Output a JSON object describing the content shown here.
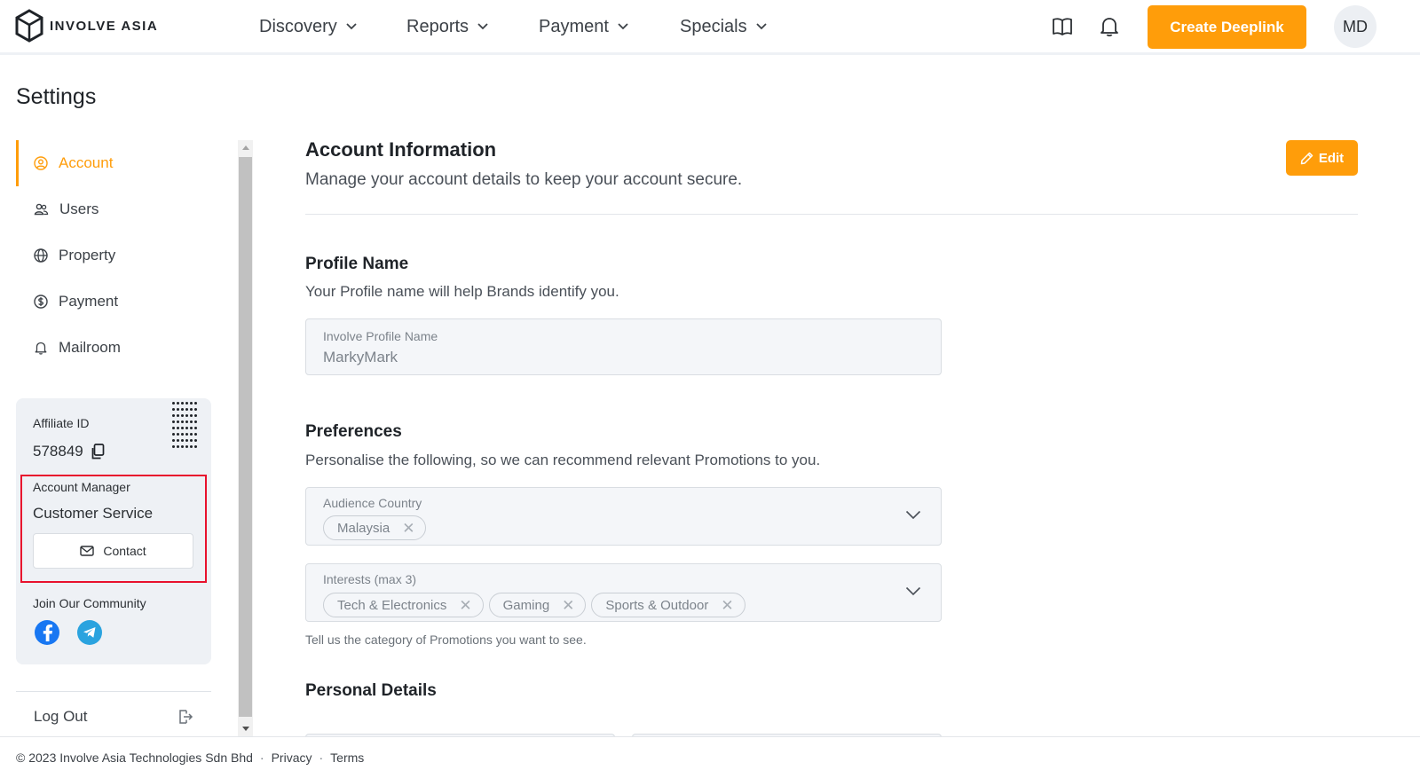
{
  "brand": {
    "name": "INVOLVE ASIA"
  },
  "nav": {
    "items": [
      {
        "label": "Discovery"
      },
      {
        "label": "Reports"
      },
      {
        "label": "Payment"
      },
      {
        "label": "Specials"
      }
    ],
    "create_label": "Create Deeplink",
    "avatar_initials": "MD",
    "icons": [
      "book-icon",
      "bell-icon",
      "chevron-down-icon"
    ]
  },
  "page": {
    "title": "Settings"
  },
  "sidebar": {
    "items": [
      {
        "label": "Account",
        "icon": "user-circle-icon",
        "active": true
      },
      {
        "label": "Users",
        "icon": "users-icon",
        "active": false
      },
      {
        "label": "Property",
        "icon": "globe-icon",
        "active": false
      },
      {
        "label": "Payment",
        "icon": "dollar-icon",
        "active": false
      },
      {
        "label": "Mailroom",
        "icon": "bell-icon",
        "active": false
      }
    ],
    "affiliate_label": "Affiliate ID",
    "affiliate_id": "578849",
    "manager_label": "Account Manager",
    "manager_name": "Customer Service",
    "contact_label": "Contact",
    "community_label": "Join Our Community",
    "logout_label": "Log Out"
  },
  "main": {
    "title": "Account Information",
    "subtitle": "Manage your account details to keep your account secure.",
    "edit_label": "Edit",
    "profile": {
      "title": "Profile Name",
      "desc": "Your Profile name will help Brands identify you.",
      "field_label": "Involve Profile Name",
      "field_value": "MarkyMark"
    },
    "preferences": {
      "title": "Preferences",
      "desc": "Personalise the following, so we can recommend relevant Promotions to you.",
      "country_label": "Audience Country",
      "countries": [
        "Malaysia"
      ],
      "interests_label": "Interests (max 3)",
      "interests": [
        "Tech & Electronics",
        "Gaming",
        "Sports & Outdoor"
      ],
      "helper": "Tell us the category of Promotions you want to see."
    },
    "personal": {
      "title": "Personal Details"
    }
  },
  "footer": {
    "copyright": "© 2023 Involve Asia Technologies Sdn Bhd",
    "sep": "·",
    "privacy": "Privacy",
    "terms": "Terms"
  },
  "colors": {
    "accent": "#ff9d0a",
    "highlight": "#e8112d",
    "facebook": "#1877f2",
    "telegram": "#2aa3df"
  }
}
